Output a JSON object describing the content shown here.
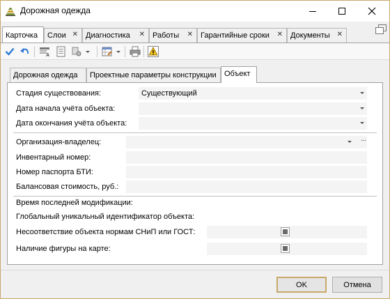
{
  "window": {
    "title": "Дорожная одежда"
  },
  "doc_tabs": [
    {
      "label": "Карточка",
      "active": true
    },
    {
      "label": "Слои"
    },
    {
      "label": "Диагностика"
    },
    {
      "label": "Работы"
    },
    {
      "label": "Гарантийные сроки"
    },
    {
      "label": "Документы"
    }
  ],
  "inner_tabs": [
    {
      "label": "Дорожная одежда"
    },
    {
      "label": "Проектные параметры конструкции"
    },
    {
      "label": "Объект",
      "active": true
    }
  ],
  "form": {
    "stage_label": "Стадия существования:",
    "stage_value": "Существующий",
    "start_date_label": "Дата начала учёта объекта:",
    "start_date_value": "",
    "end_date_label": "Дата окончания учёта объекта:",
    "end_date_value": "",
    "owner_label": "Организация-владелец:",
    "owner_value": "",
    "owner_ellipsis": "···",
    "inventory_label": "Инвентарный номер:",
    "inventory_value": "",
    "bti_label": "Номер паспорта БТИ:",
    "bti_value": "",
    "balance_label": "Балансовая стоимость, руб.:",
    "balance_value": "",
    "last_mod_label": "Время последней модификации:",
    "guid_label": "Глобальный уникальный идентификатор объекта:",
    "snip_label": "Несоответствие объекта нормам СНиП или ГОСТ:",
    "map_label": "Наличие фигуры на карте:"
  },
  "buttons": {
    "ok": "OK",
    "cancel": "Отмена"
  },
  "colors": {
    "window_border": "#c8a86a",
    "save_check": "#2b79d6",
    "warning": "#f0c020"
  }
}
